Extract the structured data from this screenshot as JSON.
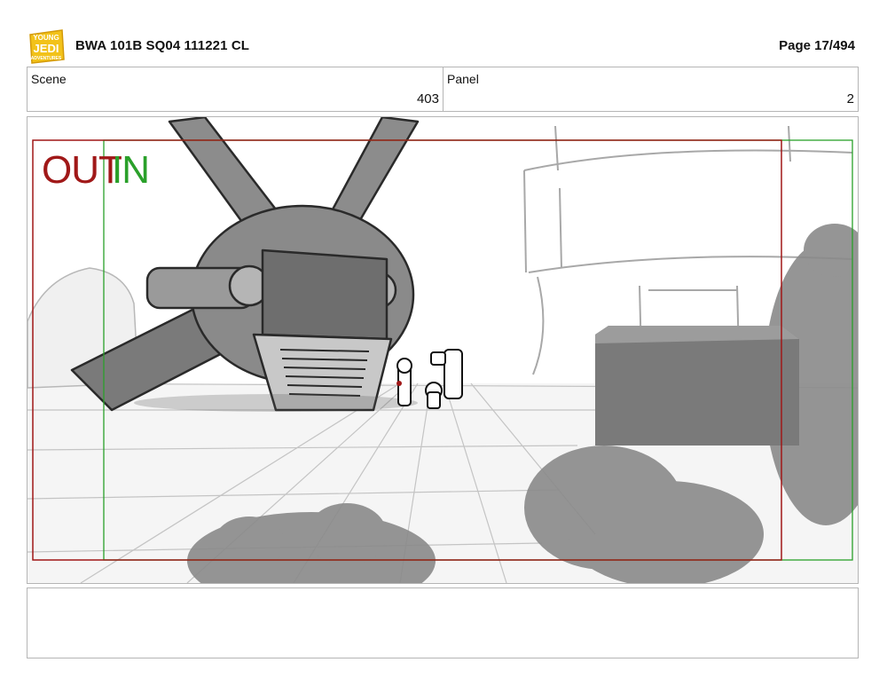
{
  "header": {
    "logo_icon": "young-jedi-adventures-logo",
    "logo_text_line1": "YOUNG",
    "logo_text_line2": "JEDI",
    "logo_text_line3": "ADVENTURES",
    "title": "BWA 101B SQ04 111221 CL",
    "page_label": "Page  17/494"
  },
  "meta": {
    "scene_label": "Scene",
    "scene_value": "403",
    "panel_label": "Panel",
    "panel_value": "2"
  },
  "frame": {
    "out_label": "OUT",
    "in_label": "IN",
    "out_color": "#a01818",
    "in_color": "#2aa02a",
    "illustration_icon": "storyboard-sketch-crashed-ship"
  },
  "notes": {
    "text": ""
  }
}
